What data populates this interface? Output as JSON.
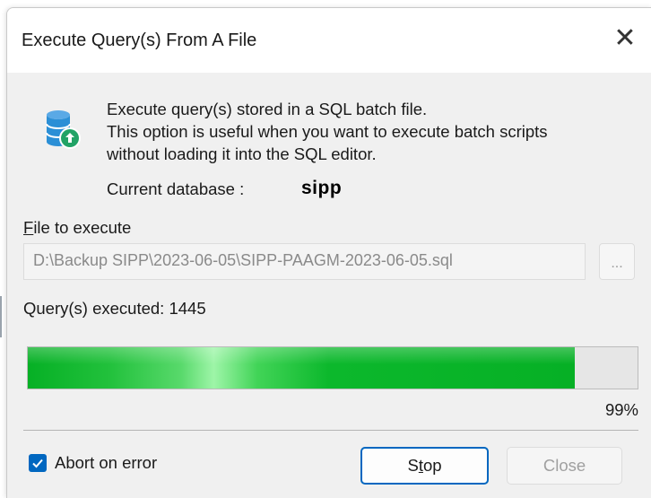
{
  "dialog": {
    "title": "Execute Query(s) From A File",
    "description": [
      "Execute query(s) stored in a SQL batch file.",
      "This option is useful when you want to execute batch scripts",
      "without loading it into the SQL editor."
    ],
    "current_database_label": "Current database :",
    "current_database_value": "sipp",
    "file_label_mnemonic": "F",
    "file_label_rest": "ile to execute",
    "file_path": "D:\\Backup SIPP\\2023-06-05\\SIPP-PAAGM-2023-06-05.sql",
    "browse_label": "...",
    "executed_text": "Query(s) executed: 1445",
    "progress_percent": 99,
    "progress_label": "99%",
    "abort_on_error_label": "Abort on error",
    "abort_on_error_checked": true,
    "stop_label_pre": "S",
    "stop_label_mnemonic": "t",
    "stop_label_post": "op",
    "close_label": "Close"
  },
  "colors": {
    "accent": "#0067c0",
    "progress_green": "#06b025",
    "db_icon_blue": "#2b8fd6",
    "db_badge_green": "#21a366"
  },
  "icons": {
    "close": "close-icon",
    "database": "database-upload-icon",
    "checkmark": "checkmark-icon"
  }
}
